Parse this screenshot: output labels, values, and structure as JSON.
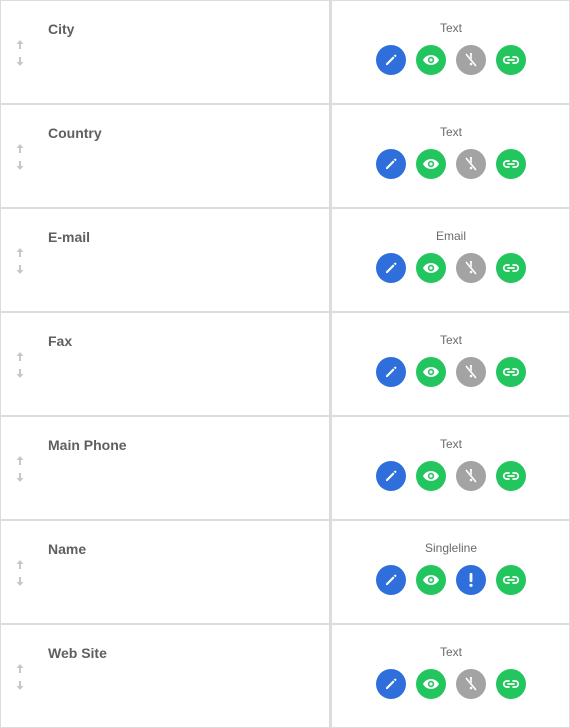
{
  "colors": {
    "edit": "#2f6fdb",
    "view": "#22c55e",
    "required_off": "#a3a3a3",
    "required_on": "#2f6fdb",
    "link": "#22c55e",
    "border": "#dcdcdc"
  },
  "fields": [
    {
      "name": "City",
      "type": "Text",
      "required": false
    },
    {
      "name": "Country",
      "type": "Text",
      "required": false
    },
    {
      "name": "E-mail",
      "type": "Email",
      "required": false
    },
    {
      "name": "Fax",
      "type": "Text",
      "required": false
    },
    {
      "name": "Main Phone",
      "type": "Text",
      "required": false
    },
    {
      "name": "Name",
      "type": "Singleline",
      "required": true
    },
    {
      "name": "Web Site",
      "type": "Text",
      "required": false
    }
  ],
  "icons": {
    "sort": "sort-arrows-icon",
    "edit": "pencil-icon",
    "view": "eye-icon",
    "required_off": "not-required-icon",
    "required_on": "required-exclamation-icon",
    "link": "link-icon"
  }
}
